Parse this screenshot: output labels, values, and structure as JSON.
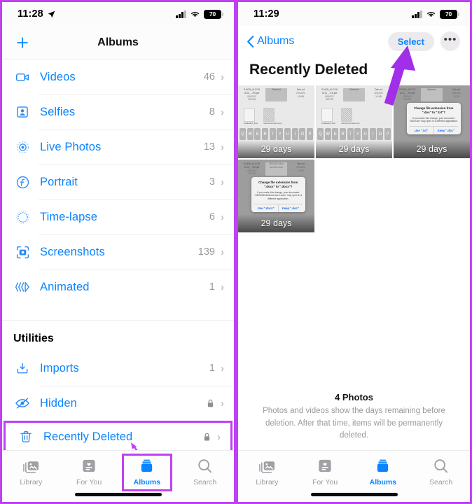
{
  "left": {
    "status": {
      "time": "11:28",
      "battery": "70",
      "location_icon": "location-arrow-icon",
      "cellular_icon": "signal-bars-icon",
      "wifi_icon": "wifi-icon"
    },
    "nav": {
      "title": "Albums",
      "add_icon": "plus-icon"
    },
    "albums": [
      {
        "label": "Videos",
        "count": "46",
        "icon": "video-camera-icon"
      },
      {
        "label": "Selfies",
        "count": "8",
        "icon": "portrait-person-icon"
      },
      {
        "label": "Live Photos",
        "count": "13",
        "icon": "live-photo-icon"
      },
      {
        "label": "Portrait",
        "count": "3",
        "icon": "aperture-f-icon"
      },
      {
        "label": "Time-lapse",
        "count": "6",
        "icon": "timelapse-icon"
      },
      {
        "label": "Screenshots",
        "count": "139",
        "icon": "screenshot-icon"
      },
      {
        "label": "Animated",
        "count": "1",
        "icon": "animated-chevrons-icon"
      }
    ],
    "utilities_header": "Utilities",
    "utilities": [
      {
        "label": "Imports",
        "count": "1",
        "icon": "import-tray-icon",
        "locked": false
      },
      {
        "label": "Hidden",
        "count": "",
        "icon": "eye-slash-icon",
        "locked": true
      },
      {
        "label": "Recently Deleted",
        "count": "",
        "icon": "trash-icon",
        "locked": true,
        "highlighted": true
      }
    ],
    "tabs": [
      {
        "label": "Library",
        "icon": "photo-stack-icon",
        "active": false
      },
      {
        "label": "For You",
        "icon": "for-you-card-icon",
        "active": false
      },
      {
        "label": "Albums",
        "icon": "albums-stack-icon",
        "active": true,
        "highlighted": true
      },
      {
        "label": "Search",
        "icon": "magnifier-icon",
        "active": false
      }
    ]
  },
  "right": {
    "status": {
      "time": "11:29",
      "battery": "70"
    },
    "nav": {
      "back_label": "Albums",
      "back_icon": "chevron-left-icon",
      "select_label": "Select",
      "more_icon": "ellipsis-icon"
    },
    "title": "Recently Deleted",
    "thumbnails": [
      {
        "days": "29 days",
        "kind": "keyboard",
        "dialog": false
      },
      {
        "days": "29 days",
        "kind": "keyboard",
        "dialog": false
      },
      {
        "days": "29 days",
        "kind": "dialog",
        "dialog": true,
        "dialog_title": "Change file extension from \".doc\" to \".txt\"?",
        "dialog_body": "If you make this change, your document “Gavin.txt” may open in a different application.",
        "dialog_primary": "Use \".txt\"",
        "dialog_secondary": "Keep \".doc\""
      },
      {
        "days": "29 days",
        "kind": "dialog",
        "dialog": true,
        "dialog_title": "Change file extension from \".docx\" to \".docx\"?",
        "dialog_body": "If you make this change, your document “1591525134Annexure-I.docx” may open in a different application.",
        "dialog_primary": "Use \".docx\"",
        "dialog_secondary": "Keep \".doc\""
      }
    ],
    "file_labels": {
      "col1": "S-NON_ALCOH OLIC_...ES.pdf",
      "col2": "Gavin.txt",
      "col3": "Deb.vcf",
      "file_a": "evaluated_files",
      "file_b": "redimensionar2.php"
    },
    "keyboard_keys": [
      "Q",
      "W",
      "E",
      "R",
      "T",
      "Y",
      "U",
      "I",
      "O",
      "P"
    ],
    "footer": {
      "count": "4 Photos",
      "description": "Photos and videos show the days remaining before deletion. After that time, items will be permanently deleted."
    },
    "tabs": [
      {
        "label": "Library",
        "icon": "photo-stack-icon",
        "active": false
      },
      {
        "label": "For You",
        "icon": "for-you-card-icon",
        "active": false
      },
      {
        "label": "Albums",
        "icon": "albums-stack-icon",
        "active": true
      },
      {
        "label": "Search",
        "icon": "magnifier-icon",
        "active": false
      }
    ]
  },
  "annotations": {
    "accent_color": "#c041f4",
    "highlight_recently_deleted": "box",
    "highlight_albums_tab": "box",
    "arrow_to_albums_tab": "arrow",
    "arrow_to_select": "arrow"
  }
}
